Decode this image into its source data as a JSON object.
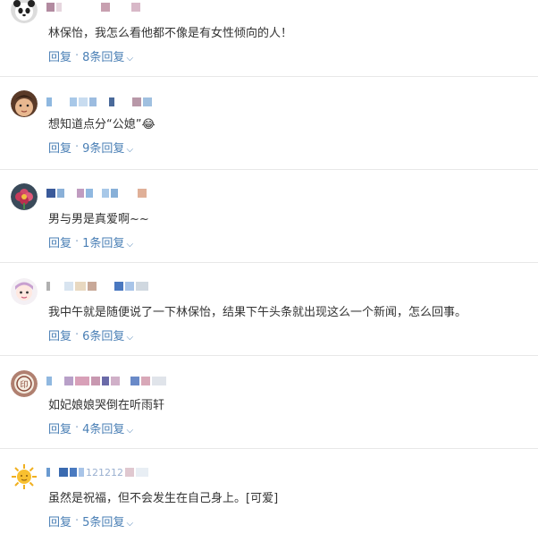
{
  "comments": [
    {
      "text": "林保怡，我怎么看他都不像是有女性倾向的人！",
      "reply_label": "回复",
      "replies_label": "8条回复",
      "avatar_icon": "panda-avatar-icon"
    },
    {
      "text": "想知道点分“公媳”😂",
      "reply_label": "回复",
      "replies_label": "9条回复",
      "avatar_icon": "child-avatar-icon"
    },
    {
      "text": "男与男是真爱啊~~",
      "reply_label": "回复",
      "replies_label": "1条回复",
      "avatar_icon": "flower-avatar-icon"
    },
    {
      "text": "我中午就是随便说了一下林保怡，结果下午头条就出现这么一个新闻，怎么回事。",
      "reply_label": "回复",
      "replies_label": "6条回复",
      "avatar_icon": "cartoon-avatar-icon"
    },
    {
      "text": "如妃娘娘哭倒在听雨轩",
      "reply_label": "回复",
      "replies_label": "4条回复",
      "avatar_icon": "seal-avatar-icon"
    },
    {
      "text": "虽然是祝福，但不会发生在自己身上。[可爱]",
      "reply_label": "回复",
      "replies_label": "5条回复",
      "avatar_icon": "sun-avatar-icon"
    }
  ],
  "name_partial_text": {
    "row6": "121212"
  },
  "colors": {
    "link": "#4a7fb5",
    "text": "#333333",
    "divider": "#e8e8e8"
  }
}
